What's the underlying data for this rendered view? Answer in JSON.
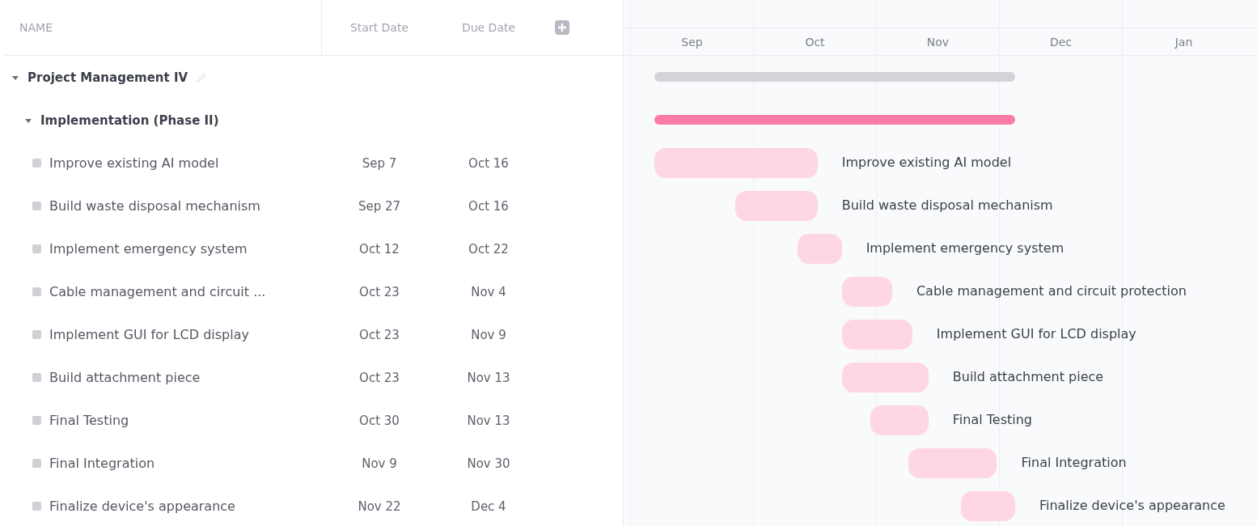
{
  "table": {
    "columns": [
      "NAME",
      "Start Date",
      "Due Date"
    ]
  },
  "gantt": {
    "months": [
      "Sep",
      "Oct",
      "Nov",
      "Dec",
      "Jan"
    ]
  },
  "project": {
    "name": "Project Management IV",
    "expanded": true,
    "groups": [
      {
        "name": "Implementation (Phase II)",
        "expanded": true,
        "tasks": [
          {
            "name": "Improve existing AI model",
            "start": "Sep 7",
            "due": "Oct 16",
            "chart_label": "Improve existing AI model"
          },
          {
            "name": "Build waste disposal mechanism",
            "start": "Sep 27",
            "due": "Oct 16",
            "chart_label": "Build waste disposal mechanism"
          },
          {
            "name": "Implement emergency system",
            "start": "Oct 12",
            "due": "Oct 22",
            "chart_label": "Implement emergency system"
          },
          {
            "name": "Cable management and circuit ...",
            "start": "Oct 23",
            "due": "Nov 4",
            "chart_label": "Cable management and circuit protection"
          },
          {
            "name": "Implement GUI for LCD display",
            "start": "Oct 23",
            "due": "Nov 9",
            "chart_label": "Implement GUI for LCD display"
          },
          {
            "name": "Build attachment piece",
            "start": "Oct 23",
            "due": "Nov 13",
            "chart_label": "Build attachment piece"
          },
          {
            "name": "Final Testing",
            "start": "Oct 30",
            "due": "Nov 13",
            "chart_label": "Final Testing"
          },
          {
            "name": "Final Integration",
            "start": "Nov 9",
            "due": "Nov 30",
            "chart_label": "Final Integration"
          },
          {
            "name": "Finalize device's appearance",
            "start": "Nov 22",
            "due": "Dec 4",
            "chart_label": "Finalize device's appearance"
          }
        ]
      }
    ]
  }
}
